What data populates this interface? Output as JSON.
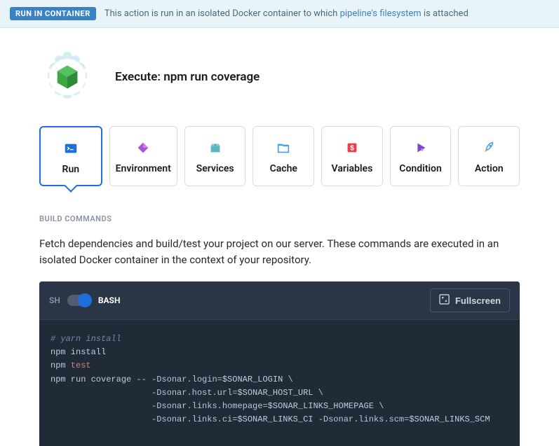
{
  "banner": {
    "badge": "RUN IN CONTAINER",
    "text_before": "This action is run in an isolated Docker container to which ",
    "link": "pipeline's filesystem",
    "text_after": " is attached"
  },
  "header": {
    "title": "Execute: npm run coverage"
  },
  "tabs": [
    {
      "label": "Run"
    },
    {
      "label": "Environment"
    },
    {
      "label": "Services"
    },
    {
      "label": "Cache"
    },
    {
      "label": "Variables"
    },
    {
      "label": "Condition"
    },
    {
      "label": "Action"
    }
  ],
  "section": {
    "title": "BUILD COMMANDS",
    "desc": "Fetch dependencies and build/test your project on our server. These commands are executed in an isolated Docker container in the context of your repository."
  },
  "editor": {
    "sh": "SH",
    "bash": "BASH",
    "fullscreen": "Fullscreen",
    "code": {
      "line1_comment": "# yarn install",
      "line2": "npm install",
      "line3_cmd": "npm ",
      "line3_test": "test",
      "line4_cmd": "npm run coverage ",
      "dd": "--",
      "sp": " ",
      "d1_flag": "-Dsonar.login",
      "d1_val": "$SONAR_LOGIN",
      "d2_flag": "-Dsonar.host.url",
      "d2_val": "$SONAR_HOST_URL",
      "d3_flag": "-Dsonar.links.homepage",
      "d3_val": "$SONAR_LINKS_HOMEPAGE",
      "d4_flag": "-Dsonar.links.ci",
      "d4_val": "$SONAR_LINKS_CI",
      "d5_flag": "-Dsonar.links.scm",
      "d5_val": "$SONAR_LINKS_SCM",
      "bs": " \\",
      "eq": "=",
      "indent": "                    "
    }
  }
}
